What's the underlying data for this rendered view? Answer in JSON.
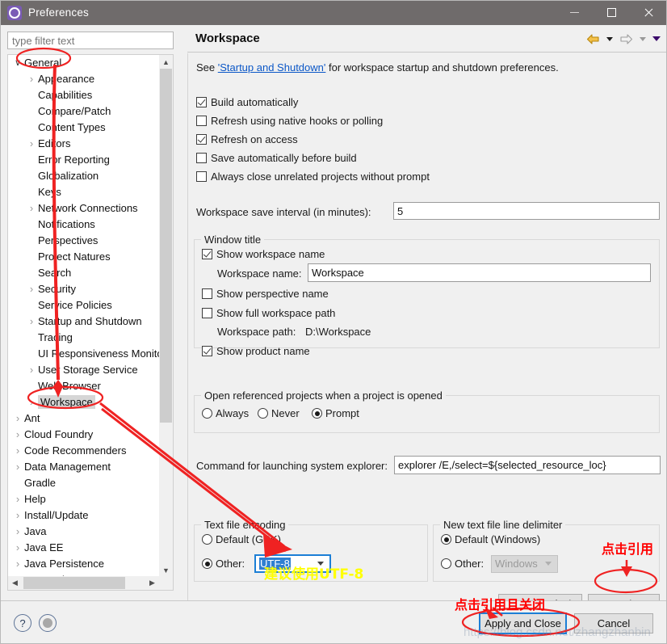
{
  "window": {
    "title": "Preferences",
    "icon": "preferences-gear-icon",
    "minimize_label": "—",
    "maximize_label": "□",
    "close_label": "✕"
  },
  "sidebar": {
    "filter_placeholder": "type filter text",
    "filter_value": "",
    "selected": "Workspace",
    "items": [
      {
        "label": "General",
        "depth": 0,
        "twisty": "down",
        "selected": false
      },
      {
        "label": "Appearance",
        "depth": 1,
        "twisty": "right",
        "selected": false
      },
      {
        "label": "Capabilities",
        "depth": 1,
        "twisty": "none",
        "selected": false
      },
      {
        "label": "Compare/Patch",
        "depth": 1,
        "twisty": "none",
        "selected": false
      },
      {
        "label": "Content Types",
        "depth": 1,
        "twisty": "none",
        "selected": false
      },
      {
        "label": "Editors",
        "depth": 1,
        "twisty": "right",
        "selected": false
      },
      {
        "label": "Error Reporting",
        "depth": 1,
        "twisty": "none",
        "selected": false
      },
      {
        "label": "Globalization",
        "depth": 1,
        "twisty": "none",
        "selected": false
      },
      {
        "label": "Keys",
        "depth": 1,
        "twisty": "none",
        "selected": false
      },
      {
        "label": "Network Connections",
        "depth": 1,
        "twisty": "right",
        "selected": false
      },
      {
        "label": "Notifications",
        "depth": 1,
        "twisty": "none",
        "selected": false
      },
      {
        "label": "Perspectives",
        "depth": 1,
        "twisty": "none",
        "selected": false
      },
      {
        "label": "Project Natures",
        "depth": 1,
        "twisty": "none",
        "selected": false
      },
      {
        "label": "Search",
        "depth": 1,
        "twisty": "none",
        "selected": false
      },
      {
        "label": "Security",
        "depth": 1,
        "twisty": "right",
        "selected": false
      },
      {
        "label": "Service Policies",
        "depth": 1,
        "twisty": "none",
        "selected": false
      },
      {
        "label": "Startup and Shutdown",
        "depth": 1,
        "twisty": "right",
        "selected": false
      },
      {
        "label": "Tracing",
        "depth": 1,
        "twisty": "none",
        "selected": false
      },
      {
        "label": "UI Responsiveness Monito",
        "depth": 1,
        "twisty": "none",
        "selected": false
      },
      {
        "label": "User Storage Service",
        "depth": 1,
        "twisty": "right",
        "selected": false
      },
      {
        "label": "Web Browser",
        "depth": 1,
        "twisty": "none",
        "selected": false
      },
      {
        "label": "Workspace",
        "depth": 1,
        "twisty": "right",
        "selected": true
      },
      {
        "label": "Ant",
        "depth": 0,
        "twisty": "right",
        "selected": false
      },
      {
        "label": "Cloud Foundry",
        "depth": 0,
        "twisty": "right",
        "selected": false
      },
      {
        "label": "Code Recommenders",
        "depth": 0,
        "twisty": "right",
        "selected": false
      },
      {
        "label": "Data Management",
        "depth": 0,
        "twisty": "right",
        "selected": false
      },
      {
        "label": "Gradle",
        "depth": 0,
        "twisty": "none",
        "selected": false
      },
      {
        "label": "Help",
        "depth": 0,
        "twisty": "right",
        "selected": false
      },
      {
        "label": "Install/Update",
        "depth": 0,
        "twisty": "right",
        "selected": false
      },
      {
        "label": "Java",
        "depth": 0,
        "twisty": "right",
        "selected": false
      },
      {
        "label": "Java EE",
        "depth": 0,
        "twisty": "right",
        "selected": false
      },
      {
        "label": "Java Persistence",
        "depth": 0,
        "twisty": "right",
        "selected": false
      },
      {
        "label": "JavaScript",
        "depth": 0,
        "twisty": "right",
        "selected": false
      }
    ]
  },
  "page": {
    "title": "Workspace",
    "intro_prefix": "See ",
    "intro_link": "'Startup and Shutdown'",
    "intro_suffix": " for workspace startup and shutdown preferences.",
    "checkboxes": [
      {
        "label": "Build automatically",
        "checked": true
      },
      {
        "label": "Refresh using native hooks or polling",
        "checked": false
      },
      {
        "label": "Refresh on access",
        "checked": true
      },
      {
        "label": "Save automatically before build",
        "checked": false
      },
      {
        "label": "Always close unrelated projects without prompt",
        "checked": false
      }
    ],
    "save_interval_label": "Workspace save interval (in minutes):",
    "save_interval_value": "5",
    "window_title_group": {
      "legend": "Window title",
      "show_workspace_name": {
        "label": "Show workspace name",
        "checked": true
      },
      "workspace_name_label": "Workspace name:",
      "workspace_name_value": "Workspace",
      "show_perspective_name": {
        "label": "Show perspective name",
        "checked": false
      },
      "show_full_workspace_path": {
        "label": "Show full workspace path",
        "checked": false
      },
      "workspace_path_label": "Workspace path:",
      "workspace_path_value": "D:\\Workspace",
      "show_product_name": {
        "label": "Show product name",
        "checked": true
      }
    },
    "open_referenced_group": {
      "legend": "Open referenced projects when a project is opened",
      "options": [
        {
          "label": "Always",
          "selected": false
        },
        {
          "label": "Never",
          "selected": false
        },
        {
          "label": "Prompt",
          "selected": true
        }
      ]
    },
    "explorer_command_label": "Command for launching system explorer:",
    "explorer_command_value": "explorer /E,/select=${selected_resource_loc}",
    "encoding_group": {
      "legend": "Text file encoding",
      "default_option": {
        "label": "Default (GBK)",
        "selected": false
      },
      "other_option": {
        "label": "Other:",
        "selected": true
      },
      "other_value": "UTF-8",
      "other_focused": true
    },
    "delimiter_group": {
      "legend": "New text file line delimiter",
      "default_option": {
        "label": "Default (Windows)",
        "selected": true
      },
      "other_option": {
        "label": "Other:",
        "selected": false
      },
      "other_value": "Windows",
      "other_disabled": true
    },
    "restore_defaults_label": "Restore Defaults",
    "apply_label": "Apply"
  },
  "footer": {
    "help_icon": "question-mark-icon",
    "shell_icon": "filled-circle-icon",
    "apply_and_close_label": "Apply and Close",
    "cancel_label": "Cancel"
  },
  "annotations": {
    "note_apply": "点击引用",
    "note_apply_and_close": "点击引用且关闭",
    "note_utf8": "建议使用UTF-8",
    "watermark": "https://blog.csdn.net/zhangzhanbin",
    "color_red": "#ff0000",
    "color_yellow": "#ffff00",
    "color_blue": "#1c6fd0"
  }
}
